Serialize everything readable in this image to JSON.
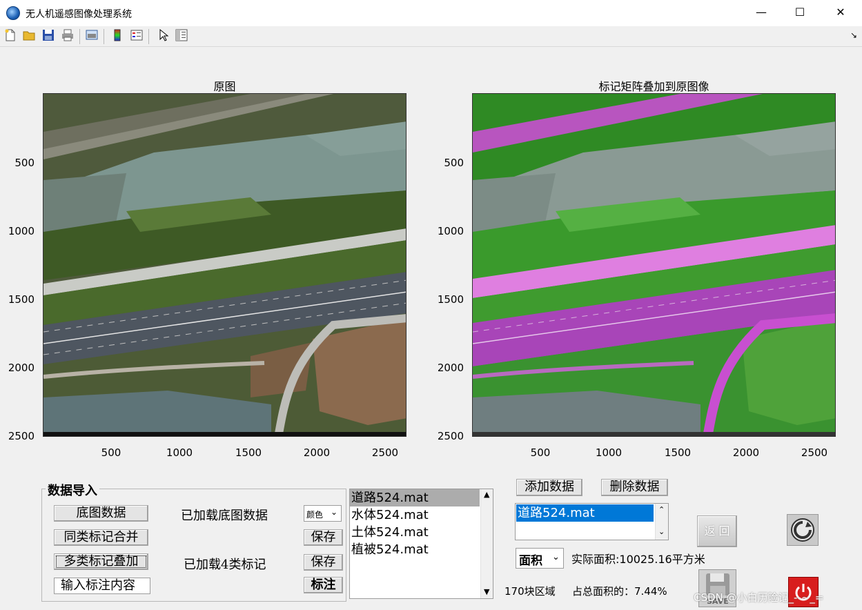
{
  "window": {
    "title": "无人机遥感图像处理系统",
    "minimize": "—",
    "maximize": "☐",
    "close": "✕"
  },
  "toolbar": {
    "icons": [
      "new-file-icon",
      "open-folder-icon",
      "save-icon",
      "print-icon",
      "print-preview-icon",
      "colorbar-icon",
      "legend-icon",
      "pointer-icon",
      "property-inspector-icon"
    ],
    "dock": "↘"
  },
  "axes_left": {
    "title": "原图",
    "yticks": [
      "500",
      "1000",
      "1500",
      "2000",
      "2500"
    ],
    "xticks": [
      "500",
      "1000",
      "1500",
      "2000",
      "2500"
    ]
  },
  "axes_right": {
    "title": "标记矩阵叠加到原图像",
    "yticks": [
      "500",
      "1000",
      "1500",
      "2000",
      "2500"
    ],
    "xticks": [
      "500",
      "1000",
      "1500",
      "2000",
      "2500"
    ]
  },
  "import_panel": {
    "title": "数据导入",
    "base_button": "底图数据",
    "base_status": "已加载底图数据",
    "color_select": "颜色",
    "merge_button": "同类标记合并",
    "save1": "保存",
    "overlay_button": "多类标记叠加",
    "overlay_status": "已加载4类标记",
    "save2": "保存",
    "annotation_input": "输入标注内容",
    "annotate_button": "标注"
  },
  "file_list": {
    "items": [
      "道路524.mat",
      "水体524.mat",
      "土体524.mat",
      "植被524.mat"
    ],
    "selected": 0
  },
  "data_controls": {
    "add": "添加数据",
    "delete": "删除数据",
    "selected_list": [
      "道路524.mat"
    ],
    "metric_select": "面积",
    "actual_area": "实际面积:10025.16平方米",
    "regions": "170块区域",
    "ratio": "占总面积的：7.44%",
    "back": "返 回",
    "save_label": "SAVE"
  },
  "watermark": "CSDN @小白历险记_--~_=",
  "colors": {
    "road_overlay": "#c84fd0",
    "vegetation_overlay": "#3f9b2f",
    "selection": "#0078d7",
    "power": "#d81e1e"
  }
}
